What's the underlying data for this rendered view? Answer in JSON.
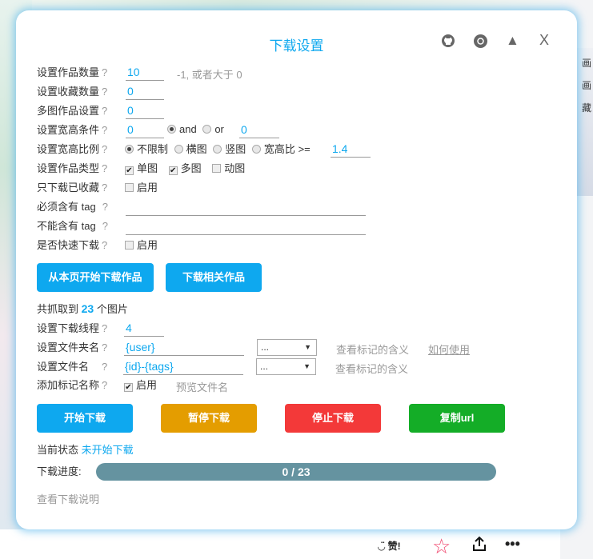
{
  "background": {
    "side_items": [
      "画",
      "画",
      "藏"
    ],
    "like_label": "赞!",
    "icons": [
      "smile-icon",
      "star-icon",
      "share-icon",
      "more-icon"
    ]
  },
  "header": {
    "title": "下载设置",
    "icons": [
      "github-icon",
      "chrome-icon",
      "collapse-icon",
      "close-icon"
    ],
    "close_label": "X"
  },
  "help_mark": "?",
  "settings": {
    "work_count": {
      "label": "设置作品数量",
      "value": "10",
      "hint": "-1, 或者大于 0"
    },
    "fav_count": {
      "label": "设置收藏数量",
      "value": "0"
    },
    "multi_image": {
      "label": "多图作品设置",
      "value": "0"
    },
    "size": {
      "label": "设置宽高条件",
      "width": "0",
      "and": "and",
      "or": "or",
      "height": "0",
      "selected": "and"
    },
    "ratio": {
      "label": "设置宽高比例",
      "options": [
        "不限制",
        "横图",
        "竖图",
        "宽高比"
      ],
      "selected": "不限制",
      "ge": ">=",
      "value": "1.4"
    },
    "type": {
      "label": "设置作品类型",
      "options": [
        {
          "label": "单图",
          "checked": true
        },
        {
          "label": "多图",
          "checked": true
        },
        {
          "label": "动图",
          "checked": false
        }
      ]
    },
    "only_fav": {
      "label": "只下载已收藏",
      "option": "启用",
      "checked": false
    },
    "must_tag": {
      "label": "必须含有 tag",
      "value": ""
    },
    "no_tag": {
      "label": "不能含有 tag",
      "value": ""
    },
    "quick": {
      "label": "是否快速下载",
      "option": "启用",
      "checked": false
    }
  },
  "actions": {
    "start_from_page": "从本页开始下载作品",
    "download_related": "下载相关作品"
  },
  "result": {
    "prefix": "共抓取到",
    "count": "23",
    "suffix": "个图片"
  },
  "download": {
    "threads": {
      "label": "设置下载线程",
      "value": "4"
    },
    "folder": {
      "label": "设置文件夹名",
      "value": "{user}",
      "select": "...",
      "meaning": "查看标记的含义",
      "how": "如何使用"
    },
    "filename": {
      "label": "设置文件名",
      "value": "{id}-{tags}",
      "select": "...",
      "meaning": "查看标记的含义"
    },
    "tag_name": {
      "label": "添加标记名称",
      "option": "启用",
      "checked": true,
      "preview": "预览文件名"
    }
  },
  "buttons": {
    "start": "开始下载",
    "pause": "暂停下载",
    "stop": "停止下载",
    "copy": "复制url"
  },
  "colors": {
    "accent": "#0ea8ef",
    "start": "#0ea8ef",
    "pause": "#e49d00",
    "stop": "#f33939",
    "copy": "#14ad27",
    "progress": "#6593a0"
  },
  "status": {
    "label": "当前状态",
    "value": "未开始下载"
  },
  "progress": {
    "label": "下载进度:",
    "text": "0 / 23",
    "fraction": 0
  },
  "help_link": "查看下载说明"
}
